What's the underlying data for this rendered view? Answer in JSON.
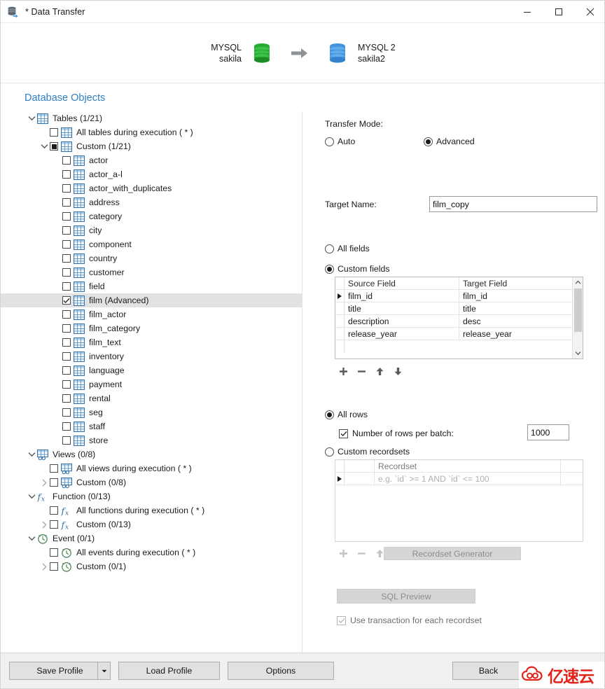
{
  "window": {
    "title": "* Data Transfer",
    "icon": "data-transfer-icon",
    "minimize_label": "Minimize",
    "maximize_label": "Maximize",
    "close_label": "Close"
  },
  "connections": {
    "source": {
      "name": "MYSQL",
      "database": "sakila",
      "icon": "database-icon-green",
      "color": "#22a12a"
    },
    "arrow": "arrow-right-icon",
    "target": {
      "name": "MYSQL 2",
      "database": "sakila2",
      "icon": "database-icon-blue",
      "color": "#3f93e0"
    }
  },
  "section": {
    "title": "Database Objects",
    "color": "#2f7fc1"
  },
  "tree": [
    {
      "level": 0,
      "twist": "down",
      "checkbox": "none",
      "icon": "table-icon",
      "label": "Tables (1/21)",
      "selected": false
    },
    {
      "level": 1,
      "twist": "none",
      "checkbox": "unchecked",
      "icon": "table-icon",
      "label": "All tables during execution ( * )",
      "selected": false
    },
    {
      "level": 1,
      "twist": "down",
      "checkbox": "partial",
      "icon": "table-icon",
      "label": "Custom (1/21)",
      "selected": false
    },
    {
      "level": 2,
      "twist": "none",
      "checkbox": "unchecked",
      "icon": "table-icon",
      "label": "actor",
      "selected": false
    },
    {
      "level": 2,
      "twist": "none",
      "checkbox": "unchecked",
      "icon": "table-icon",
      "label": "actor_a-l",
      "selected": false
    },
    {
      "level": 2,
      "twist": "none",
      "checkbox": "unchecked",
      "icon": "table-icon",
      "label": "actor_with_duplicates",
      "selected": false
    },
    {
      "level": 2,
      "twist": "none",
      "checkbox": "unchecked",
      "icon": "table-icon",
      "label": "address",
      "selected": false
    },
    {
      "level": 2,
      "twist": "none",
      "checkbox": "unchecked",
      "icon": "table-icon",
      "label": "category",
      "selected": false
    },
    {
      "level": 2,
      "twist": "none",
      "checkbox": "unchecked",
      "icon": "table-icon",
      "label": "city",
      "selected": false
    },
    {
      "level": 2,
      "twist": "none",
      "checkbox": "unchecked",
      "icon": "table-icon",
      "label": "component",
      "selected": false
    },
    {
      "level": 2,
      "twist": "none",
      "checkbox": "unchecked",
      "icon": "table-icon",
      "label": "country",
      "selected": false
    },
    {
      "level": 2,
      "twist": "none",
      "checkbox": "unchecked",
      "icon": "table-icon",
      "label": "customer",
      "selected": false
    },
    {
      "level": 2,
      "twist": "none",
      "checkbox": "unchecked",
      "icon": "table-icon",
      "label": "field",
      "selected": false
    },
    {
      "level": 2,
      "twist": "none",
      "checkbox": "checked",
      "icon": "table-icon",
      "label": "film (Advanced)",
      "selected": true
    },
    {
      "level": 2,
      "twist": "none",
      "checkbox": "unchecked",
      "icon": "table-icon",
      "label": "film_actor",
      "selected": false
    },
    {
      "level": 2,
      "twist": "none",
      "checkbox": "unchecked",
      "icon": "table-icon",
      "label": "film_category",
      "selected": false
    },
    {
      "level": 2,
      "twist": "none",
      "checkbox": "unchecked",
      "icon": "table-icon",
      "label": "film_text",
      "selected": false
    },
    {
      "level": 2,
      "twist": "none",
      "checkbox": "unchecked",
      "icon": "table-icon",
      "label": "inventory",
      "selected": false
    },
    {
      "level": 2,
      "twist": "none",
      "checkbox": "unchecked",
      "icon": "table-icon",
      "label": "language",
      "selected": false
    },
    {
      "level": 2,
      "twist": "none",
      "checkbox": "unchecked",
      "icon": "table-icon",
      "label": "payment",
      "selected": false
    },
    {
      "level": 2,
      "twist": "none",
      "checkbox": "unchecked",
      "icon": "table-icon",
      "label": "rental",
      "selected": false
    },
    {
      "level": 2,
      "twist": "none",
      "checkbox": "unchecked",
      "icon": "table-icon",
      "label": "seg",
      "selected": false
    },
    {
      "level": 2,
      "twist": "none",
      "checkbox": "unchecked",
      "icon": "table-icon",
      "label": "staff",
      "selected": false
    },
    {
      "level": 2,
      "twist": "none",
      "checkbox": "unchecked",
      "icon": "table-icon",
      "label": "store",
      "selected": false
    },
    {
      "level": 0,
      "twist": "down",
      "checkbox": "none",
      "icon": "view-icon",
      "label": "Views (0/8)",
      "selected": false
    },
    {
      "level": 1,
      "twist": "none",
      "checkbox": "unchecked",
      "icon": "view-icon",
      "label": "All views during execution ( * )",
      "selected": false
    },
    {
      "level": 1,
      "twist": "right",
      "checkbox": "unchecked",
      "icon": "view-icon",
      "label": "Custom (0/8)",
      "selected": false
    },
    {
      "level": 0,
      "twist": "down",
      "checkbox": "none",
      "icon": "function-icon",
      "label": "Function (0/13)",
      "selected": false
    },
    {
      "level": 1,
      "twist": "none",
      "checkbox": "unchecked",
      "icon": "function-icon",
      "label": "All functions during execution ( * )",
      "selected": false
    },
    {
      "level": 1,
      "twist": "right",
      "checkbox": "unchecked",
      "icon": "function-icon",
      "label": "Custom (0/13)",
      "selected": false
    },
    {
      "level": 0,
      "twist": "down",
      "checkbox": "none",
      "icon": "event-icon",
      "label": "Event (0/1)",
      "selected": false
    },
    {
      "level": 1,
      "twist": "none",
      "checkbox": "unchecked",
      "icon": "event-icon",
      "label": "All events during execution ( * )",
      "selected": false
    },
    {
      "level": 1,
      "twist": "right",
      "checkbox": "unchecked",
      "icon": "event-icon",
      "label": "Custom (0/1)",
      "selected": false
    }
  ],
  "options": {
    "transfer_mode_label": "Transfer Mode:",
    "mode_auto": "Auto",
    "mode_advanced": "Advanced",
    "mode_selected": "Advanced",
    "target_name_label": "Target Name:",
    "target_name_value": "film_copy",
    "all_fields": "All fields",
    "custom_fields": "Custom fields",
    "fields_selected": "Custom fields",
    "fields_grid": {
      "columns": [
        "Source Field",
        "Target Field"
      ],
      "rows": [
        {
          "indicator": true,
          "source": "film_id",
          "target": "film_id"
        },
        {
          "indicator": false,
          "source": "title",
          "target": "title"
        },
        {
          "indicator": false,
          "source": "description",
          "target": "desc"
        },
        {
          "indicator": false,
          "source": "release_year",
          "target": "release_year"
        }
      ]
    },
    "field_tools": [
      "add-icon",
      "remove-icon",
      "move-up-icon",
      "move-down-icon"
    ],
    "all_rows": "All rows",
    "rows_selected": "All rows",
    "rows_per_batch_label": "Number of rows per batch:",
    "rows_per_batch_checked": true,
    "rows_per_batch_value": "1000",
    "custom_recordsets": "Custom recordsets",
    "recordset_grid": {
      "columns": [
        "Recordset"
      ],
      "rows": [
        {
          "indicator": true,
          "placeholder": "e.g. `id` >= 1 AND `id` <= 100"
        }
      ]
    },
    "recordset_tools": [
      "add-icon",
      "remove-icon",
      "move-up-icon",
      "move-down-icon"
    ],
    "recordset_generator": "Recordset Generator",
    "sql_preview": "SQL Preview",
    "use_transaction_label": "Use transaction for each recordset",
    "use_transaction_checked": true
  },
  "footer": {
    "save_profile": "Save Profile",
    "load_profile": "Load Profile",
    "options": "Options",
    "back": "Back",
    "watermark": "亿速云"
  }
}
